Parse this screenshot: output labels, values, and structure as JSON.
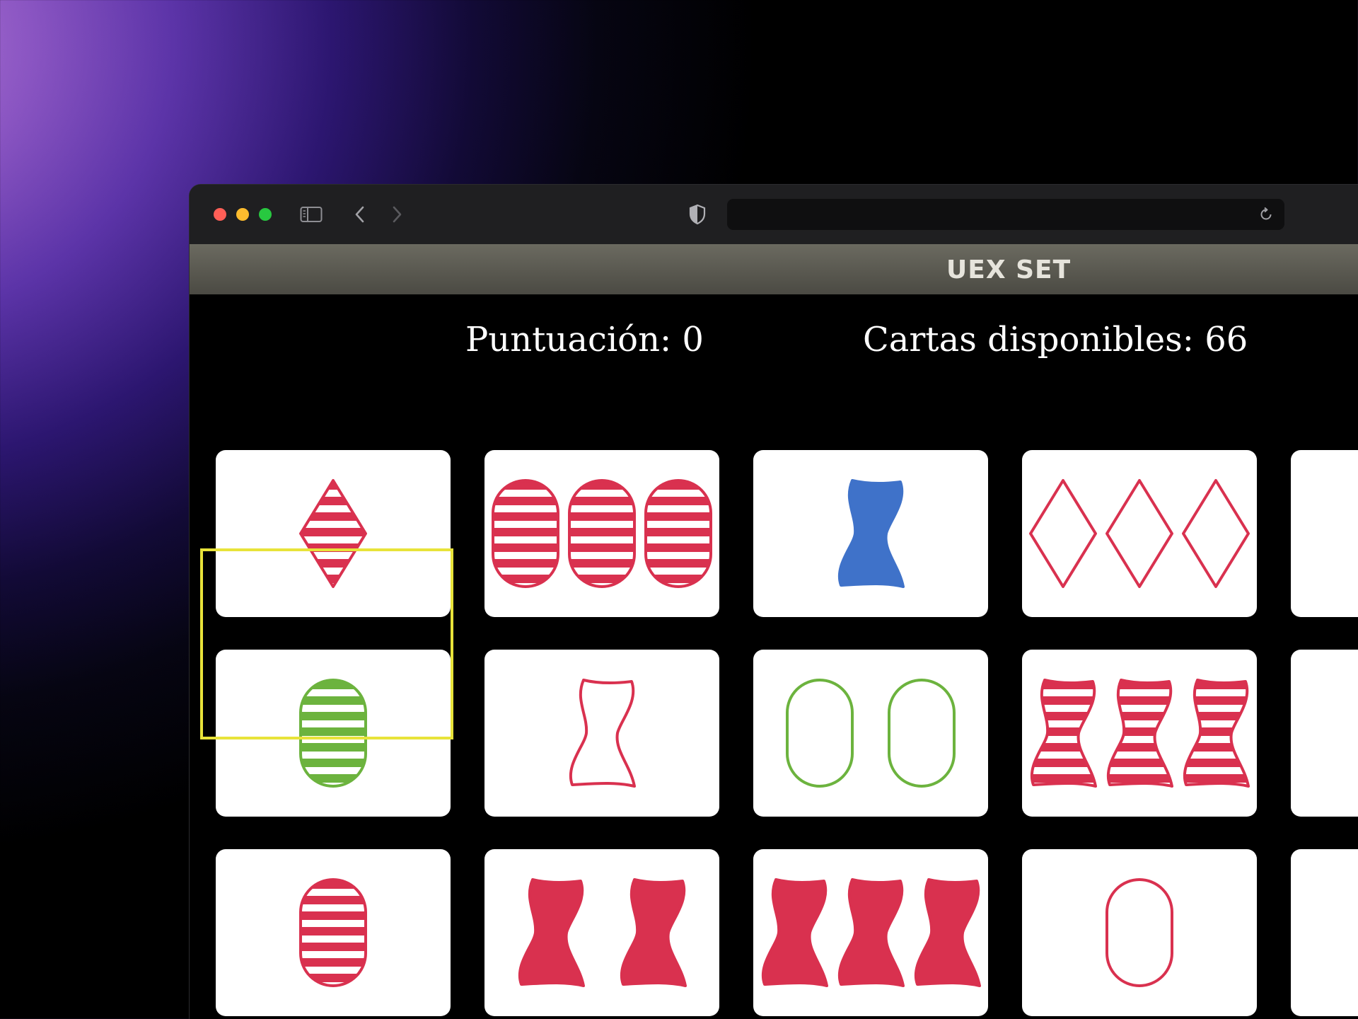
{
  "browser": {
    "url": "",
    "icons": [
      "sidebar-icon",
      "back-arrow-icon",
      "forward-arrow-icon",
      "shield-icon",
      "reload-icon"
    ]
  },
  "app": {
    "title": "UEX SET"
  },
  "stats": {
    "score_label": "Puntuación: 0",
    "cards_label": "Cartas disponibles: 66"
  },
  "colors": {
    "red": "#d9314f",
    "green": "#6cb33e",
    "blue": "#3f72c9",
    "selection": "#e8e33a"
  },
  "board": {
    "selected_index": 0,
    "cards": [
      {
        "count": 1,
        "shape": "diamond",
        "fill": "striped",
        "color": "red"
      },
      {
        "count": 3,
        "shape": "oval",
        "fill": "striped",
        "color": "red"
      },
      {
        "count": 1,
        "shape": "squiggle",
        "fill": "solid",
        "color": "blue"
      },
      {
        "count": 3,
        "shape": "diamond",
        "fill": "empty",
        "color": "red"
      },
      {
        "count": 0,
        "shape": "",
        "fill": "",
        "color": ""
      },
      {
        "count": 1,
        "shape": "oval",
        "fill": "striped",
        "color": "green"
      },
      {
        "count": 1,
        "shape": "squiggle",
        "fill": "empty",
        "color": "red"
      },
      {
        "count": 2,
        "shape": "oval",
        "fill": "empty",
        "color": "green"
      },
      {
        "count": 3,
        "shape": "squiggle",
        "fill": "striped",
        "color": "red"
      },
      {
        "count": 0,
        "shape": "",
        "fill": "",
        "color": ""
      },
      {
        "count": 1,
        "shape": "oval",
        "fill": "striped",
        "color": "red"
      },
      {
        "count": 2,
        "shape": "squiggle",
        "fill": "solid",
        "color": "red"
      },
      {
        "count": 3,
        "shape": "squiggle",
        "fill": "solid",
        "color": "red"
      },
      {
        "count": 1,
        "shape": "oval",
        "fill": "empty",
        "color": "red"
      },
      {
        "count": 0,
        "shape": "",
        "fill": "",
        "color": ""
      }
    ]
  }
}
